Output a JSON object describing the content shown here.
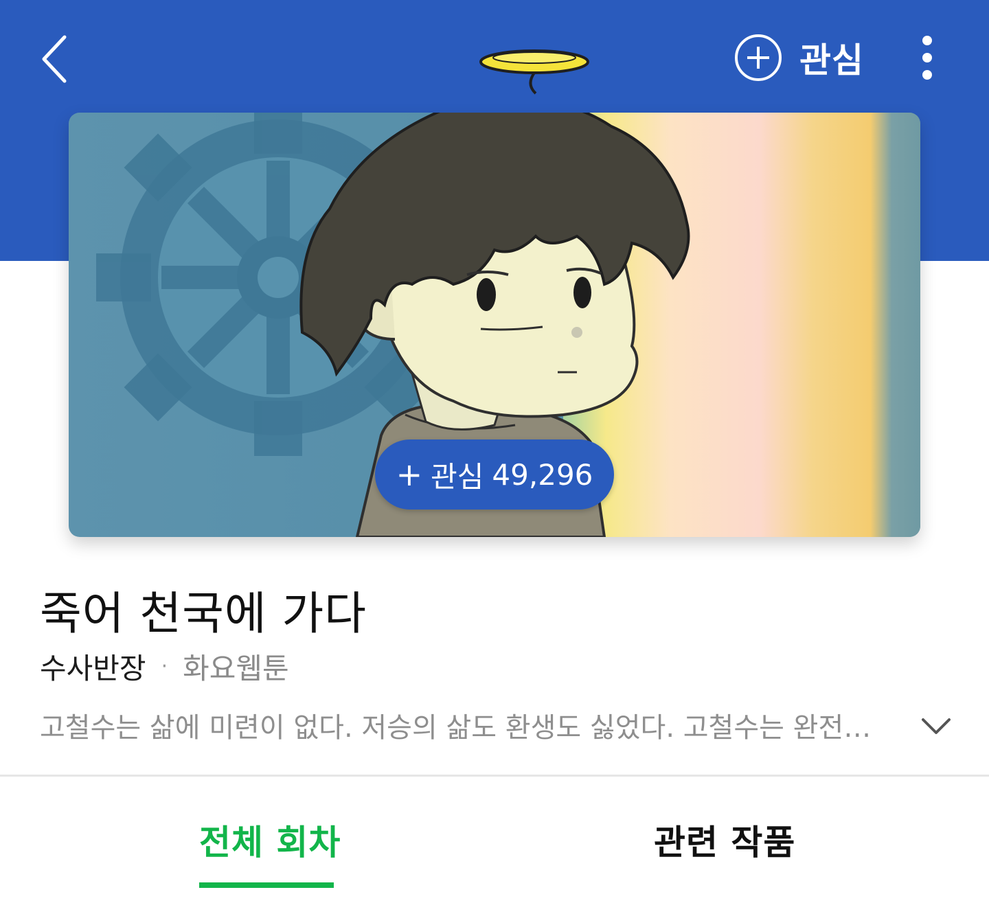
{
  "header": {
    "follow_label": "관심",
    "colors": {
      "header_bg": "#2a5bbd",
      "accent_green": "#12b54a"
    }
  },
  "cover": {
    "follow_count_label": "관심",
    "follow_count": "49,296"
  },
  "info": {
    "title": "죽어 천국에 가다",
    "author": "수사반장",
    "separator": "·",
    "publish_day": "화요웹툰",
    "description": "고철수는 삶에 미련이 없다. 저승의 삶도 환생도 싫었다. 고철수는 완전…"
  },
  "tabs": [
    {
      "label": "전체 회차",
      "active": true
    },
    {
      "label": "관련 작품",
      "active": false
    }
  ],
  "icons": {
    "back": "chevron-left-icon",
    "follow": "plus-circle-icon",
    "more": "kebab-menu-icon",
    "expand": "chevron-down-icon"
  }
}
